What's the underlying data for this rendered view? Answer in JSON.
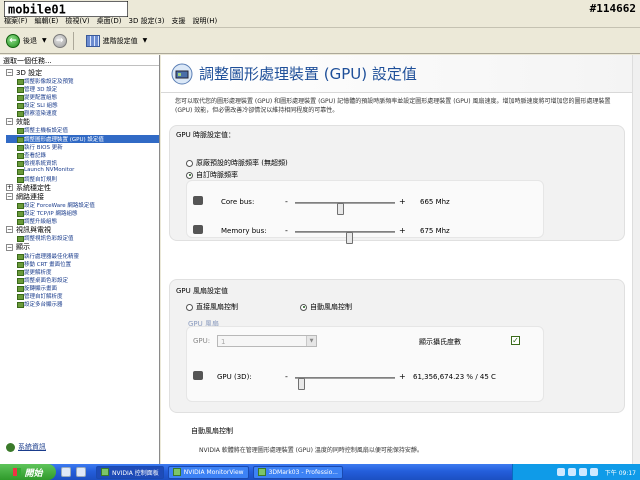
{
  "watermark": {
    "logo_text": "mobile01",
    "post_id": "#114662"
  },
  "menubar": {
    "items": [
      "檔案(F)",
      "編輯(E)",
      "檢視(V)",
      "桌面(D)",
      "3D 設定(3)",
      "支援",
      "說明(H)"
    ]
  },
  "toolbar": {
    "back_label": "後退",
    "view_tasks_label": "進階設定值"
  },
  "left_pane": {
    "header": "選取一個任務...",
    "system_info_label": "系統資訊",
    "categories": [
      {
        "label": "3D 設定",
        "expanded": true,
        "tasks": [
          "調整影像設定及預覽",
          "管理 3D 設定",
          "變更配置組態",
          "設定 SLI 組態",
          "觀察渲染速度"
        ]
      },
      {
        "label": "效能",
        "expanded": true,
        "tasks": [
          "調整主機板設定值",
          "調整圖形處理裝置 (GPU) 設定值",
          "執行 BIOS 更新",
          "查看記錄",
          "檢視系統資訊",
          "Launch NVMonitor",
          "調整自訂規則"
        ]
      },
      {
        "label": "系統穩定性",
        "expanded": false,
        "tasks": []
      },
      {
        "label": "網路連接",
        "expanded": true,
        "tasks": [
          "設定 ForceWare 網路設定值",
          "設定 TCP/IP 網路組態",
          "調整升級組態"
        ]
      },
      {
        "label": "視訊與電視",
        "expanded": true,
        "tasks": [
          "調整視訊色彩設定值"
        ]
      },
      {
        "label": "顯示",
        "expanded": true,
        "tasks": [
          "執行處理器最佳化精靈",
          "移動 CRT 畫面位置",
          "變更解析度",
          "調整桌面色彩設定",
          "旋轉顯示畫面",
          "管理自訂解析度",
          "設定多台顯示器"
        ]
      }
    ],
    "selected_task": "調整圖形處理裝置 (GPU) 設定值"
  },
  "right_pane": {
    "title": "調整圖形處理裝置 (GPU) 設定值",
    "description": "您可以取代您的圖形處理裝置 (GPU) 和圖形處理裝置 (GPU) 記憶體的預設時脈頻率並設定圖形處理裝置 (GPU) 風扇速度。增加時脈速度將可增加您的圖形處理裝置 (GPU) 效能，但必需改善冷卻情況以維持相同程度的可靠性。",
    "clock_section": {
      "title": "GPU 時脈設定值：",
      "radio_default": "原廠預設的時脈頻率 (無超頻)",
      "radio_custom": "自訂時脈頻率",
      "selected": "custom",
      "sliders": [
        {
          "label": "Core bus:",
          "value": "665 Mhz",
          "position": 0.45
        },
        {
          "label": "Memory bus:",
          "value": "675 Mhz",
          "position": 0.55
        }
      ]
    },
    "fan_section": {
      "title": "GPU 風扇設定值",
      "radio_direct": "直接風扇控制",
      "radio_auto": "自動風扇控制",
      "selected": "auto",
      "group_title": "GPU 風扇",
      "gpu_label": "GPU:",
      "gpu_value": "1",
      "show_celsius_label": "顯示攝氏度數",
      "show_celsius_checked": true,
      "slider_label": "GPU (3D):",
      "slider_value": "61,356,674.23 % / 45 C",
      "slider_position": 0.03
    },
    "bottom": {
      "title": "自動風扇控制",
      "text": "NVIDIA 軟體將在管理圖形處理裝置 (GPU) 溫度的同時控制風扇以便可能保持安靜。"
    }
  },
  "taskbar": {
    "start_label": "開始",
    "buttons": [
      {
        "label": "NVIDIA 控制面板",
        "active": true
      },
      {
        "label": "NVIDIA MonitorView",
        "active": false
      },
      {
        "label": "3DMark03 - Professio...",
        "active": false
      }
    ],
    "clock": "下午 09:17"
  },
  "colors": {
    "title_blue": "#1e4f99",
    "selection_blue": "#316ac5",
    "taskbar_blue": "#245edb",
    "tray_blue": "#0f9be8",
    "link_blue": "#1a3c8c"
  }
}
